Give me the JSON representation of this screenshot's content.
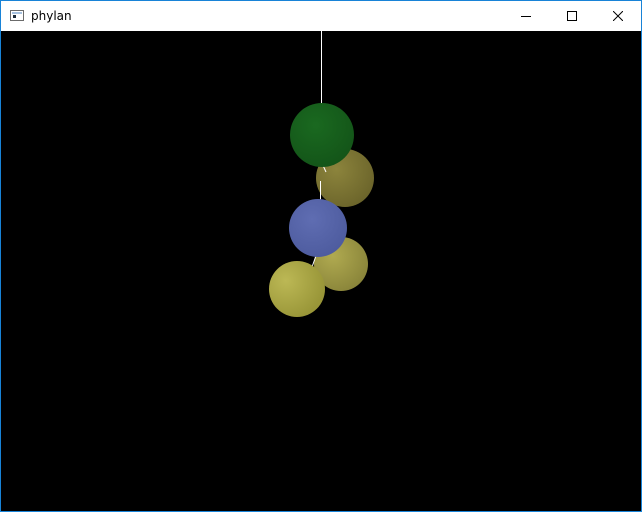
{
  "window": {
    "title": "phylan"
  },
  "titlebar": {
    "icons": {
      "app": "app-window-icon",
      "minimize": "minimize-icon",
      "maximize": "maximize-icon",
      "close": "close-icon"
    }
  },
  "scene": {
    "background_color": "#000000",
    "line_color": "#ffffff",
    "spheres": [
      {
        "name": "green-sphere",
        "color": "#17601c"
      },
      {
        "name": "olive-sphere",
        "color": "#7b7432"
      },
      {
        "name": "blue-sphere",
        "color": "#5564a8"
      },
      {
        "name": "yellow-sphere-right",
        "color": "#9c9743"
      },
      {
        "name": "yellow-sphere-left",
        "color": "#aaa743"
      }
    ]
  }
}
